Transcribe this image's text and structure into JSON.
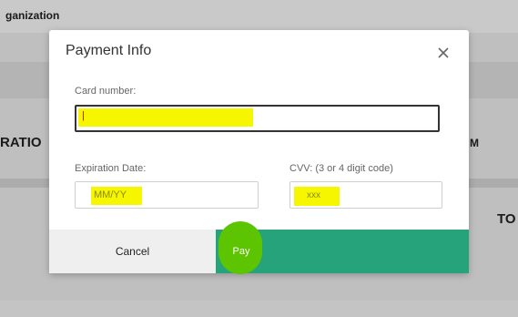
{
  "background": {
    "organization_label": "ganization",
    "column_left": "RATIO",
    "column_right": "M",
    "side_text": "TO"
  },
  "modal": {
    "title": "Payment Info",
    "card_number_label": "Card number:",
    "card_number_value": "|",
    "expiration_label": "Expiration Date:",
    "expiration_placeholder": "MM/YY",
    "cvv_label": "CVV: (3 or 4 digit code)",
    "cvv_placeholder": "xxx",
    "cancel_label": "Cancel",
    "pay_label": "Pay"
  },
  "colors": {
    "highlight_yellow": "#f6f600",
    "highlight_green": "#5cc400",
    "pay_button": "#26a37a",
    "cancel_button": "#efefef"
  }
}
